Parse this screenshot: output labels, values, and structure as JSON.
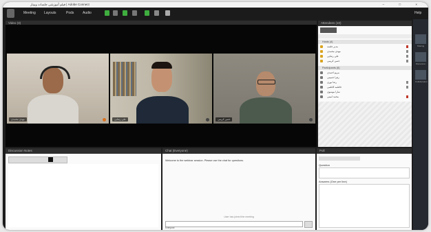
{
  "window": {
    "title": "فیلم آموزشی جلسات وبینار | Adobe Connect",
    "controls": "–  □  ×"
  },
  "menu": {
    "items": [
      "Meeting",
      "Layouts",
      "Pods",
      "Audio"
    ],
    "help": "Help"
  },
  "video": {
    "header": "Video (3)",
    "participants": [
      {
        "name": "مهدی محمدی"
      },
      {
        "name": "علی رضایی"
      },
      {
        "name": "حسن کریمی"
      }
    ]
  },
  "attendees": {
    "header": "Attendees (10)",
    "hosts_label": "Hosts (4)",
    "hosts": [
      "مدیر جلسه",
      "مهدی محمدی",
      "علی رضایی",
      "حسن کریمی"
    ],
    "participants_label": "Participants (6)",
    "participants": [
      "مریم احمدی",
      "زهرا حسینی",
      "رضا نوری",
      "فاطمه کاظمی",
      "سارا موسوی",
      "محمد امینی"
    ]
  },
  "notes": {
    "header": "Discussion Notes"
  },
  "chat": {
    "header": "Chat (Everyone)",
    "message": "Welcome to the webinar session. Please use the chat for questions.",
    "status": "User has joined the meeting",
    "recipient_label": "Everyone"
  },
  "poll": {
    "header": "Poll",
    "question_label": "Question",
    "answers_label": "Answers (One per line)"
  },
  "right_strip": {
    "thumbs": [
      "Sharing",
      "Discussion",
      "Collaboration"
    ]
  }
}
